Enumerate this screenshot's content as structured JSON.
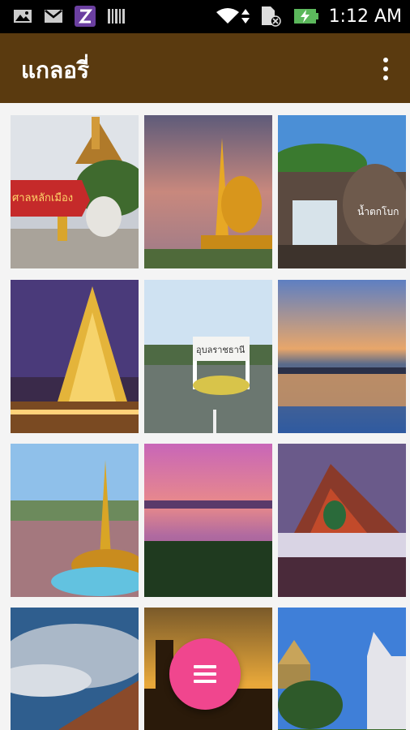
{
  "status_bar": {
    "time": "1:12 AM",
    "icons": [
      "gallery-icon",
      "gmail-icon",
      "z-app-icon",
      "barcode-icon",
      "wifi-icon",
      "data-arrows-icon",
      "sim-icon",
      "battery-charging-icon"
    ]
  },
  "app_bar": {
    "title": "แกลอรี่",
    "menu_icon": "more-vert-icon"
  },
  "gallery": {
    "photos": [
      {
        "subject": "temple-sign-elephant",
        "caption": "ศาลหลักเมือง"
      },
      {
        "subject": "golden-pagoda-naga-sunset",
        "caption": ""
      },
      {
        "subject": "waterfall-rocks",
        "caption": "น้ำตกโบก"
      },
      {
        "subject": "illuminated-golden-pagoda-night",
        "caption": ""
      },
      {
        "subject": "city-gate-sign",
        "caption": "อุบลราชธานี"
      },
      {
        "subject": "river-sunset",
        "caption": ""
      },
      {
        "subject": "candle-festival-golden-tower",
        "caption": ""
      },
      {
        "subject": "purple-sky-river",
        "caption": ""
      },
      {
        "subject": "thai-temple-dusk",
        "caption": ""
      },
      {
        "subject": "cloudy-sky-rocks",
        "caption": ""
      },
      {
        "subject": "buddha-orange-sky",
        "caption": ""
      },
      {
        "subject": "white-temple-blue-sky",
        "caption": ""
      }
    ]
  },
  "fab": {
    "icon": "menu-icon"
  },
  "colors": {
    "app_bar": "#5a3a0f",
    "fab": "#f0468e",
    "status_bar": "#000000"
  }
}
